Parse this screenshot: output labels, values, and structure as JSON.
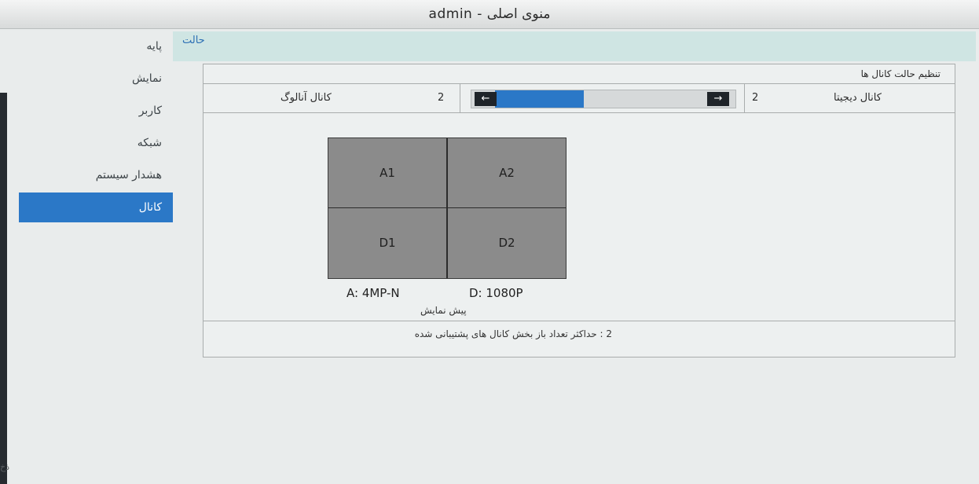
{
  "window": {
    "title": "admin - منوی اصلی"
  },
  "sidebar": {
    "items": [
      {
        "label": "پایه",
        "active": false
      },
      {
        "label": "نمایش",
        "active": false
      },
      {
        "label": "کاربر",
        "active": false
      },
      {
        "label": "شبکه",
        "active": false
      },
      {
        "label": "هشدار سیستم",
        "active": false
      },
      {
        "label": "کانال",
        "active": true
      }
    ]
  },
  "tab": {
    "label": "حالت"
  },
  "panel": {
    "title": "تنظیم حالت کانال ها",
    "analog": {
      "label": "کانال آنالوگ",
      "value": "2"
    },
    "digital": {
      "label": "کانال دیجیتا",
      "value": "2"
    },
    "slider": {
      "fill_fraction": 0.37,
      "left_arrow": "←",
      "right_arrow": "→"
    },
    "preview": {
      "quadrants": [
        "A1",
        "A2",
        "D1",
        "D2"
      ],
      "analog_resolution": "A: 4MP-N",
      "digital_resolution": "D: 1080P",
      "caption": "پیش نمایش"
    },
    "footer": "2 : حداکثر تعداد باز بخش کانال های پشتیبانی شده"
  },
  "colors": {
    "accent": "#2b78c7",
    "tab_bar": "#cfe5e3",
    "background": "#e9ecec"
  },
  "misc": {
    "corner_fragment": "ذخ"
  }
}
